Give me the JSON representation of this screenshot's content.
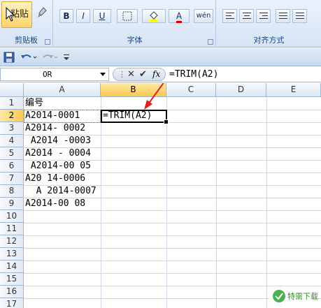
{
  "ribbon": {
    "clipboard_label": "剪贴板",
    "paste_label": "粘贴",
    "font_label": "字体",
    "align_label": "对齐方式",
    "bold": "B",
    "italic": "I",
    "underline": "U",
    "font_color": "A",
    "phonetic": "wén"
  },
  "formula_bar": {
    "name_box": "OR",
    "formula": "=TRIM(A2)",
    "fx": "fx"
  },
  "columns": [
    "A",
    "B",
    "C",
    "D",
    "E"
  ],
  "rows": [
    "1",
    "2",
    "3",
    "4",
    "5",
    "6",
    "7",
    "8",
    "9",
    "10",
    "11",
    "12",
    "13",
    "14",
    "15",
    "16",
    "17"
  ],
  "cells": {
    "A1": "编号",
    "A2": "A2014-0001",
    "A3": "A2014- 0002",
    "A4": " A2014 -0003",
    "A5": "A2014 - 0004",
    "A6": " A2014-00 05",
    "A7": "A20 14-0006",
    "A8": "  A 2014-0007",
    "A9": "A2014-00 08",
    "B2": "=TRIM(A2)"
  },
  "watermark": "特需下载",
  "colors": {
    "selected_header": "#f9c84f",
    "annotation_arrow": "#e02020"
  }
}
